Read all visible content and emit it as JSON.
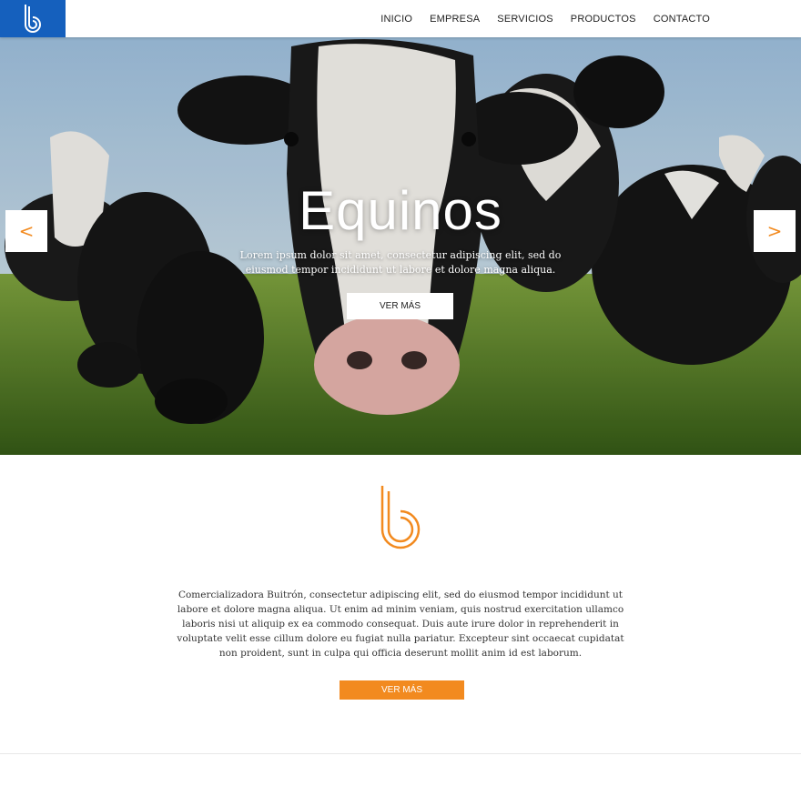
{
  "brand": {
    "logo_color": "#1560bd",
    "accent_color": "#f28a1f",
    "logo_icon": "b-logo-icon"
  },
  "nav": {
    "items": [
      {
        "label": "INICIO"
      },
      {
        "label": "EMPRESA"
      },
      {
        "label": "SERVICIOS"
      },
      {
        "label": "PRODUCTOS"
      },
      {
        "label": "CONTACTO"
      }
    ]
  },
  "hero": {
    "title": "Equinos",
    "text": "Lorem ipsum dolor sit amet, consectetur adipiscing elit, sed do eiusmod tempor incididunt ut labore et dolore magna aliqua.",
    "button_label": "VER MÁS",
    "prev_label": "<",
    "next_label": ">"
  },
  "intro": {
    "text": "Comercializadora Buitrón, consectetur adipiscing elit, sed do eiusmod tempor incididunt ut labore et dolore magna aliqua. Ut enim ad minim veniam, quis nostrud exercitation ullamco laboris nisi ut aliquip ex ea commodo consequat. Duis aute irure dolor in reprehenderit in voluptate velit esse cillum dolore eu fugiat nulla pariatur. Excepteur sint occaecat cupidatat non proident, sunt in culpa qui officia deserunt mollit anim id est laborum.",
    "button_label": "VER MÁS"
  }
}
